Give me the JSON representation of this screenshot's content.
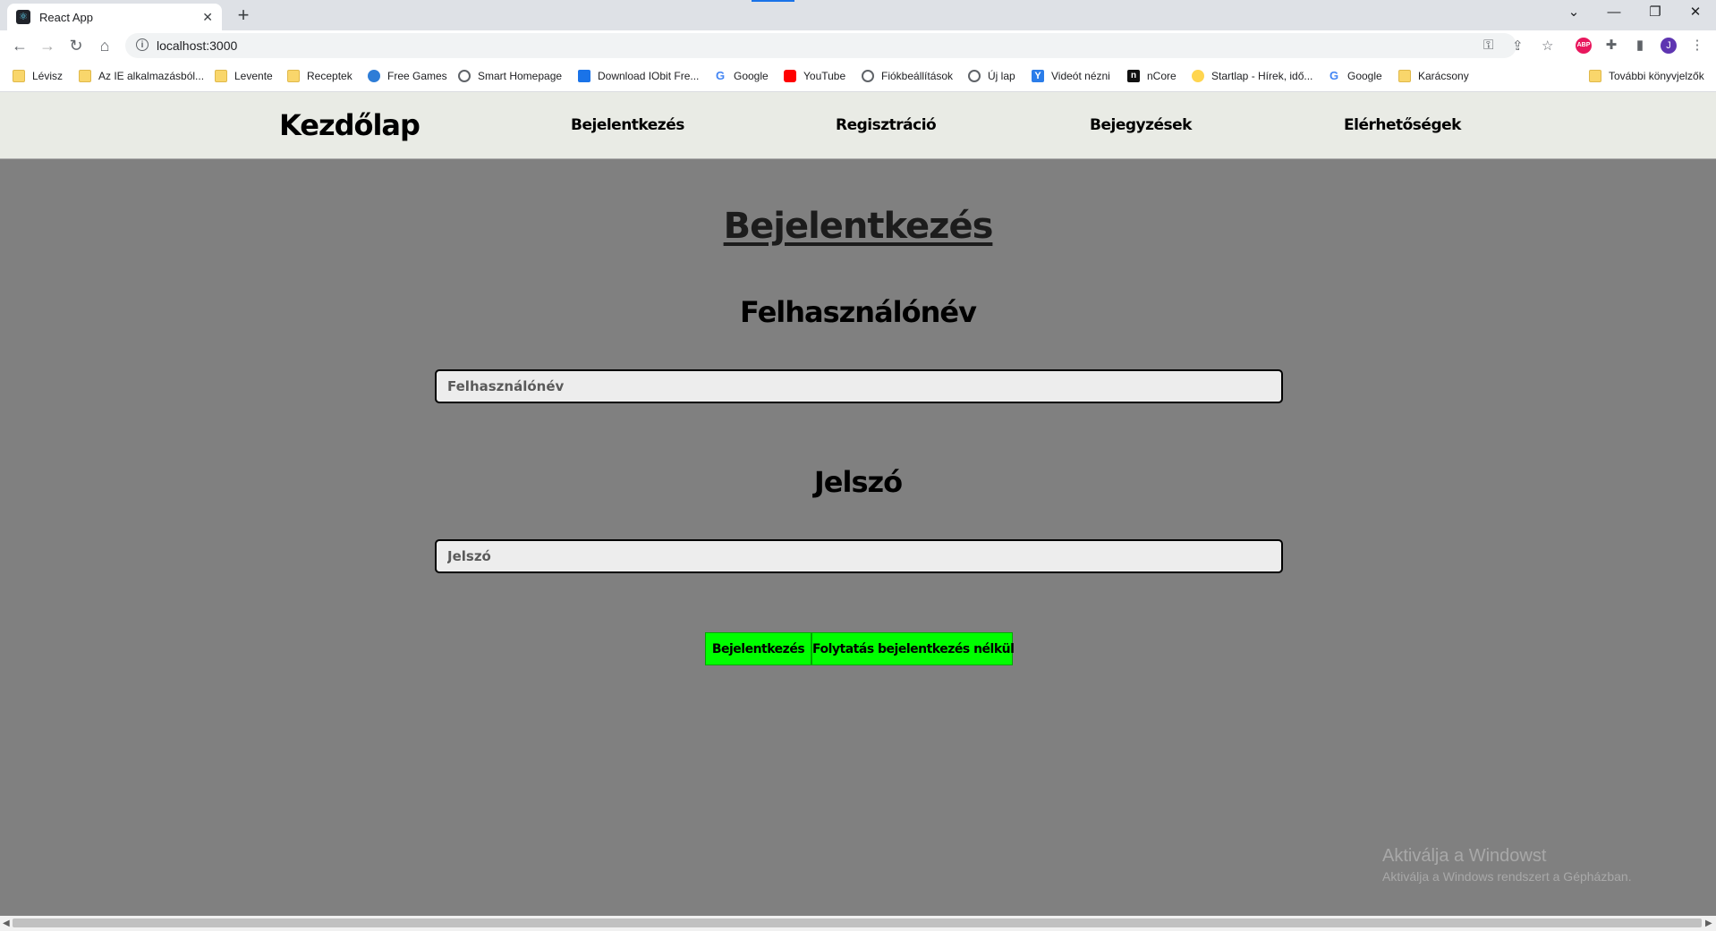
{
  "browser": {
    "tab_title": "React App",
    "tab_close": "✕",
    "new_tab": "+",
    "url": "localhost:3000",
    "window_controls": {
      "list": "⌄",
      "minimize": "—",
      "restore": "❐",
      "close": "✕"
    },
    "nav": {
      "back": "←",
      "forward": "→",
      "reload": "↻",
      "home": "⌂"
    },
    "profile_initial": "J",
    "bookmarks": [
      {
        "label": "Lévisz",
        "icon": "folder-icon"
      },
      {
        "label": "Az IE alkalmazásból...",
        "icon": "folder-icon"
      },
      {
        "label": "Levente",
        "icon": "folder-icon"
      },
      {
        "label": "Receptek",
        "icon": "folder-icon"
      },
      {
        "label": "Free Games",
        "icon": "globe-icon"
      },
      {
        "label": "Smart Homepage",
        "icon": "globe-icon"
      },
      {
        "label": "Download IObit Fre...",
        "icon": "iobit-icon"
      },
      {
        "label": "Google",
        "icon": "google-icon"
      },
      {
        "label": "YouTube",
        "icon": "youtube-icon"
      },
      {
        "label": "Fiókbeállítások",
        "icon": "globe-icon"
      },
      {
        "label": "Új lap",
        "icon": "globe-icon"
      },
      {
        "label": "Videót nézni",
        "icon": "yandex-icon"
      },
      {
        "label": "nCore",
        "icon": "ncore-icon"
      },
      {
        "label": "Startlap - Hírek, idő...",
        "icon": "startlap-icon"
      },
      {
        "label": "Google",
        "icon": "google-icon"
      },
      {
        "label": "Karácsony",
        "icon": "folder-icon"
      }
    ],
    "other_bookmarks": "További könyvjelzők"
  },
  "site_nav": {
    "home": "Kezdőlap",
    "login": "Bejelentkezés",
    "register": "Regisztráció",
    "posts": "Bejegyzések",
    "contacts": "Elérhetőségek"
  },
  "login_form": {
    "title": "Bejelentkezés",
    "username_label": "Felhasználónév",
    "username_placeholder": "Felhasználónév",
    "username_value": "",
    "password_label": "Jelszó",
    "password_placeholder": "Jelszó",
    "password_value": "",
    "login_button": "Bejelentkezés",
    "guest_button": "Folytatás bejelentkezés nélkül"
  },
  "windows_activation": {
    "line1": "Aktiválja a Windowst",
    "line2": "Aktiválja a Windows rendszert a Gépházban."
  },
  "colors": {
    "page_background": "#808080",
    "nav_background": "#e9ebe5",
    "button_green": "#00ff00"
  }
}
